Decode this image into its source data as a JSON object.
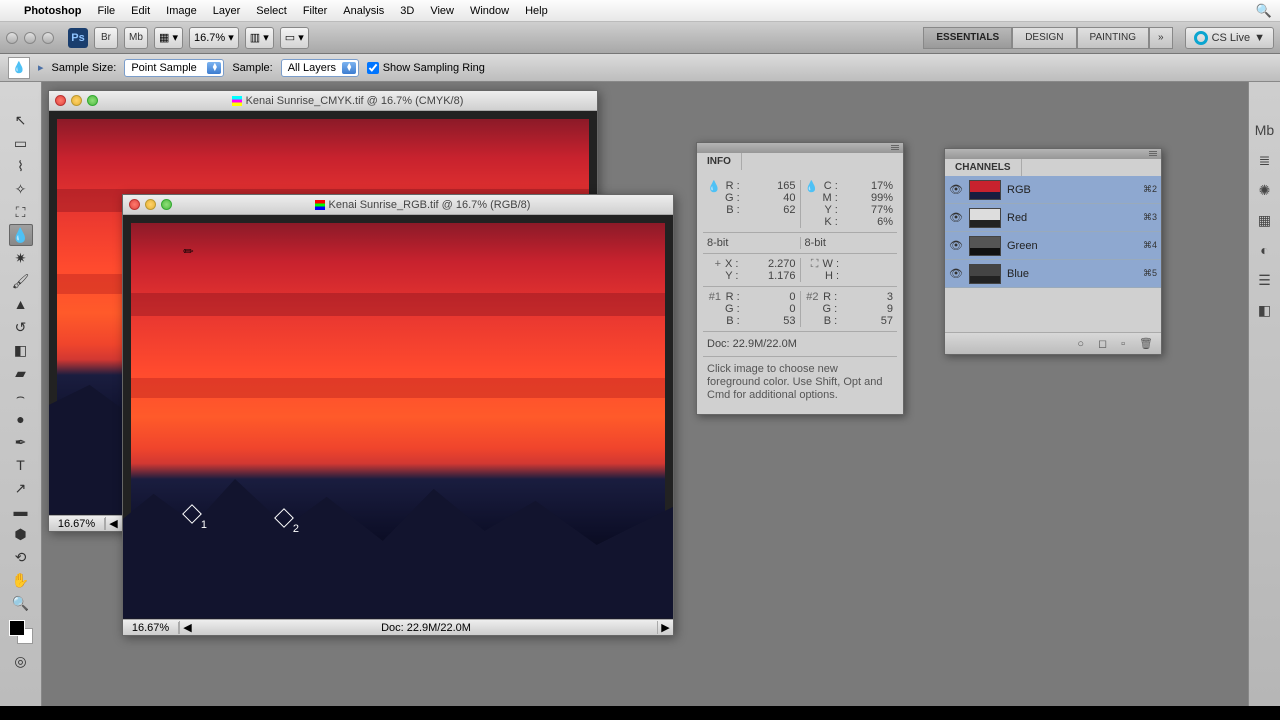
{
  "menubar": {
    "app": "Photoshop",
    "items": [
      "File",
      "Edit",
      "Image",
      "Layer",
      "Select",
      "Filter",
      "Analysis",
      "3D",
      "View",
      "Window",
      "Help"
    ]
  },
  "appbar": {
    "zoom": "16.7%",
    "workspaces": [
      "ESSENTIALS",
      "DESIGN",
      "PAINTING"
    ],
    "cslive": "CS Live"
  },
  "optbar": {
    "sample_size_label": "Sample Size:",
    "sample_size": "Point Sample",
    "sample_label": "Sample:",
    "sample": "All Layers",
    "ring": "Show Sampling Ring"
  },
  "doc_back": {
    "title": "Kenai Sunrise_CMYK.tif @ 16.7% (CMYK/8)",
    "zoom": "16.67%"
  },
  "doc_front": {
    "title": "Kenai Sunrise_RGB.tif @ 16.7% (RGB/8)",
    "zoom": "16.67%",
    "docsize": "Doc: 22.9M/22.0M"
  },
  "info": {
    "title": "INFO",
    "rgb": {
      "R": "165",
      "G": "40",
      "B": "62"
    },
    "cmyk": {
      "C": "17%",
      "M": "99%",
      "Y": "77%",
      "K": "6%"
    },
    "bits_l": "8-bit",
    "bits_r": "8-bit",
    "xy": {
      "X": "2.270",
      "Y": "1.176"
    },
    "wh": {
      "W": "",
      "H": ""
    },
    "s1": {
      "R": "0",
      "G": "0",
      "B": "53"
    },
    "s2": {
      "R": "3",
      "G": "9",
      "B": "57"
    },
    "doc": "Doc: 22.9M/22.0M",
    "hint": "Click image to choose new foreground color. Use Shift, Opt and Cmd for additional options."
  },
  "channels": {
    "title": "CHANNELS",
    "rows": [
      {
        "name": "RGB",
        "sc": "⌘2",
        "thumb": "linear-gradient(#c8222e 60%,#1a1d3f 60%)"
      },
      {
        "name": "Red",
        "sc": "⌘3",
        "thumb": "linear-gradient(#ddd 60%,#222 60%)"
      },
      {
        "name": "Green",
        "sc": "⌘4",
        "thumb": "linear-gradient(#555 60%,#111 60%)"
      },
      {
        "name": "Blue",
        "sc": "⌘5",
        "thumb": "linear-gradient(#444 60%,#222 60%)"
      }
    ]
  }
}
